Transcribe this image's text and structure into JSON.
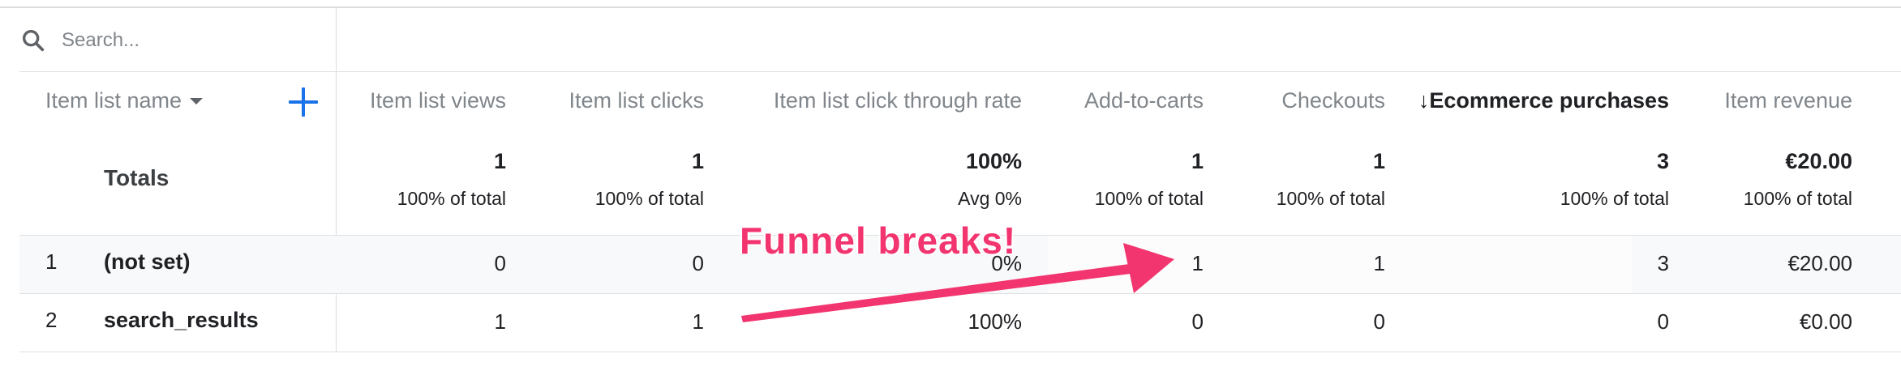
{
  "search": {
    "placeholder": "Search..."
  },
  "dimension_header": {
    "label": "Item list name"
  },
  "columns": [
    "Item list views",
    "Item list clicks",
    "Item list click through rate",
    "Add-to-carts",
    "Checkouts",
    "Ecommerce purchases",
    "Item revenue"
  ],
  "sort_indicator": "↓",
  "totals": {
    "label": "Totals",
    "values": [
      "1",
      "1",
      "100%",
      "1",
      "1",
      "3",
      "€20.00"
    ],
    "subs": [
      "100% of total",
      "100% of total",
      "Avg 0%",
      "100% of total",
      "100% of total",
      "100% of total",
      "100% of total"
    ]
  },
  "rows": [
    {
      "num": "1",
      "name": "(not set)",
      "values": [
        "0",
        "0",
        "0%",
        "1",
        "1",
        "3",
        "€20.00"
      ]
    },
    {
      "num": "2",
      "name": "search_results",
      "values": [
        "1",
        "1",
        "100%",
        "0",
        "0",
        "0",
        "€0.00"
      ]
    }
  ],
  "annotation": {
    "text": "Funnel breaks!",
    "color": "#f2346f"
  },
  "colors": {
    "accent": "#1a73e8",
    "annotation": "#f2346f"
  },
  "icons": {
    "search": "search-icon",
    "add": "plus-icon",
    "sort": "arrow-down-icon",
    "dropdown": "caret-down-icon"
  }
}
